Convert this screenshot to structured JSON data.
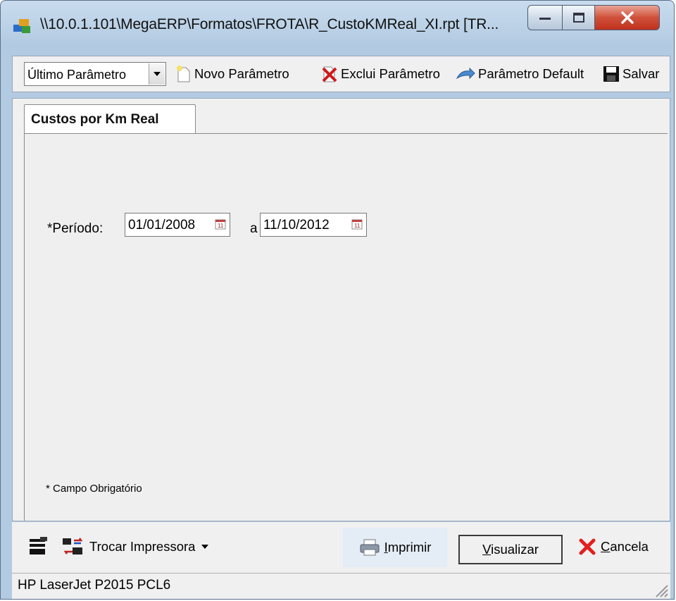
{
  "window": {
    "title": "\\\\10.0.1.101\\MegaERP\\Formatos\\FROTA\\R_CustoKMReal_XI.rpt [TR..."
  },
  "toolbar": {
    "param_select_value": "Último Parâmetro",
    "novo_label": "Novo Parâmetro",
    "exclui_label": "Exclui Parâmetro",
    "default_label": "Parâmetro Default",
    "salvar_label": "Salvar"
  },
  "tab": {
    "label": "Custos por Km Real"
  },
  "form": {
    "periodo_label": "*Período:",
    "date_from": "01/01/2008",
    "separator": "a",
    "date_to": "11/10/2012",
    "footnote": "* Campo Obrigatório"
  },
  "bottom": {
    "trocar_label": "Trocar Impressora",
    "imprimir_rest": "mprimir",
    "imprimir_key": "I",
    "visualizar_key": "V",
    "visualizar_rest": "isualizar",
    "cancela_key": "C",
    "cancela_rest": "ancela"
  },
  "status": {
    "printer": "HP LaserJet P2015 PCL6"
  },
  "colors": {
    "title_gradient_top": "#c9dcee",
    "close_red": "#c0321e",
    "face": "#f0f0f0"
  },
  "icons": [
    "app-icon",
    "minimize-icon",
    "maximize-icon",
    "close-icon",
    "dropdown-arrow-icon",
    "new-document-icon",
    "delete-x-icon",
    "default-arrow-icon",
    "save-floppy-icon",
    "calendar-icon",
    "printer-settings-icon",
    "swap-printer-icon",
    "printer-icon",
    "cancel-x-icon",
    "resize-grip-icon"
  ]
}
